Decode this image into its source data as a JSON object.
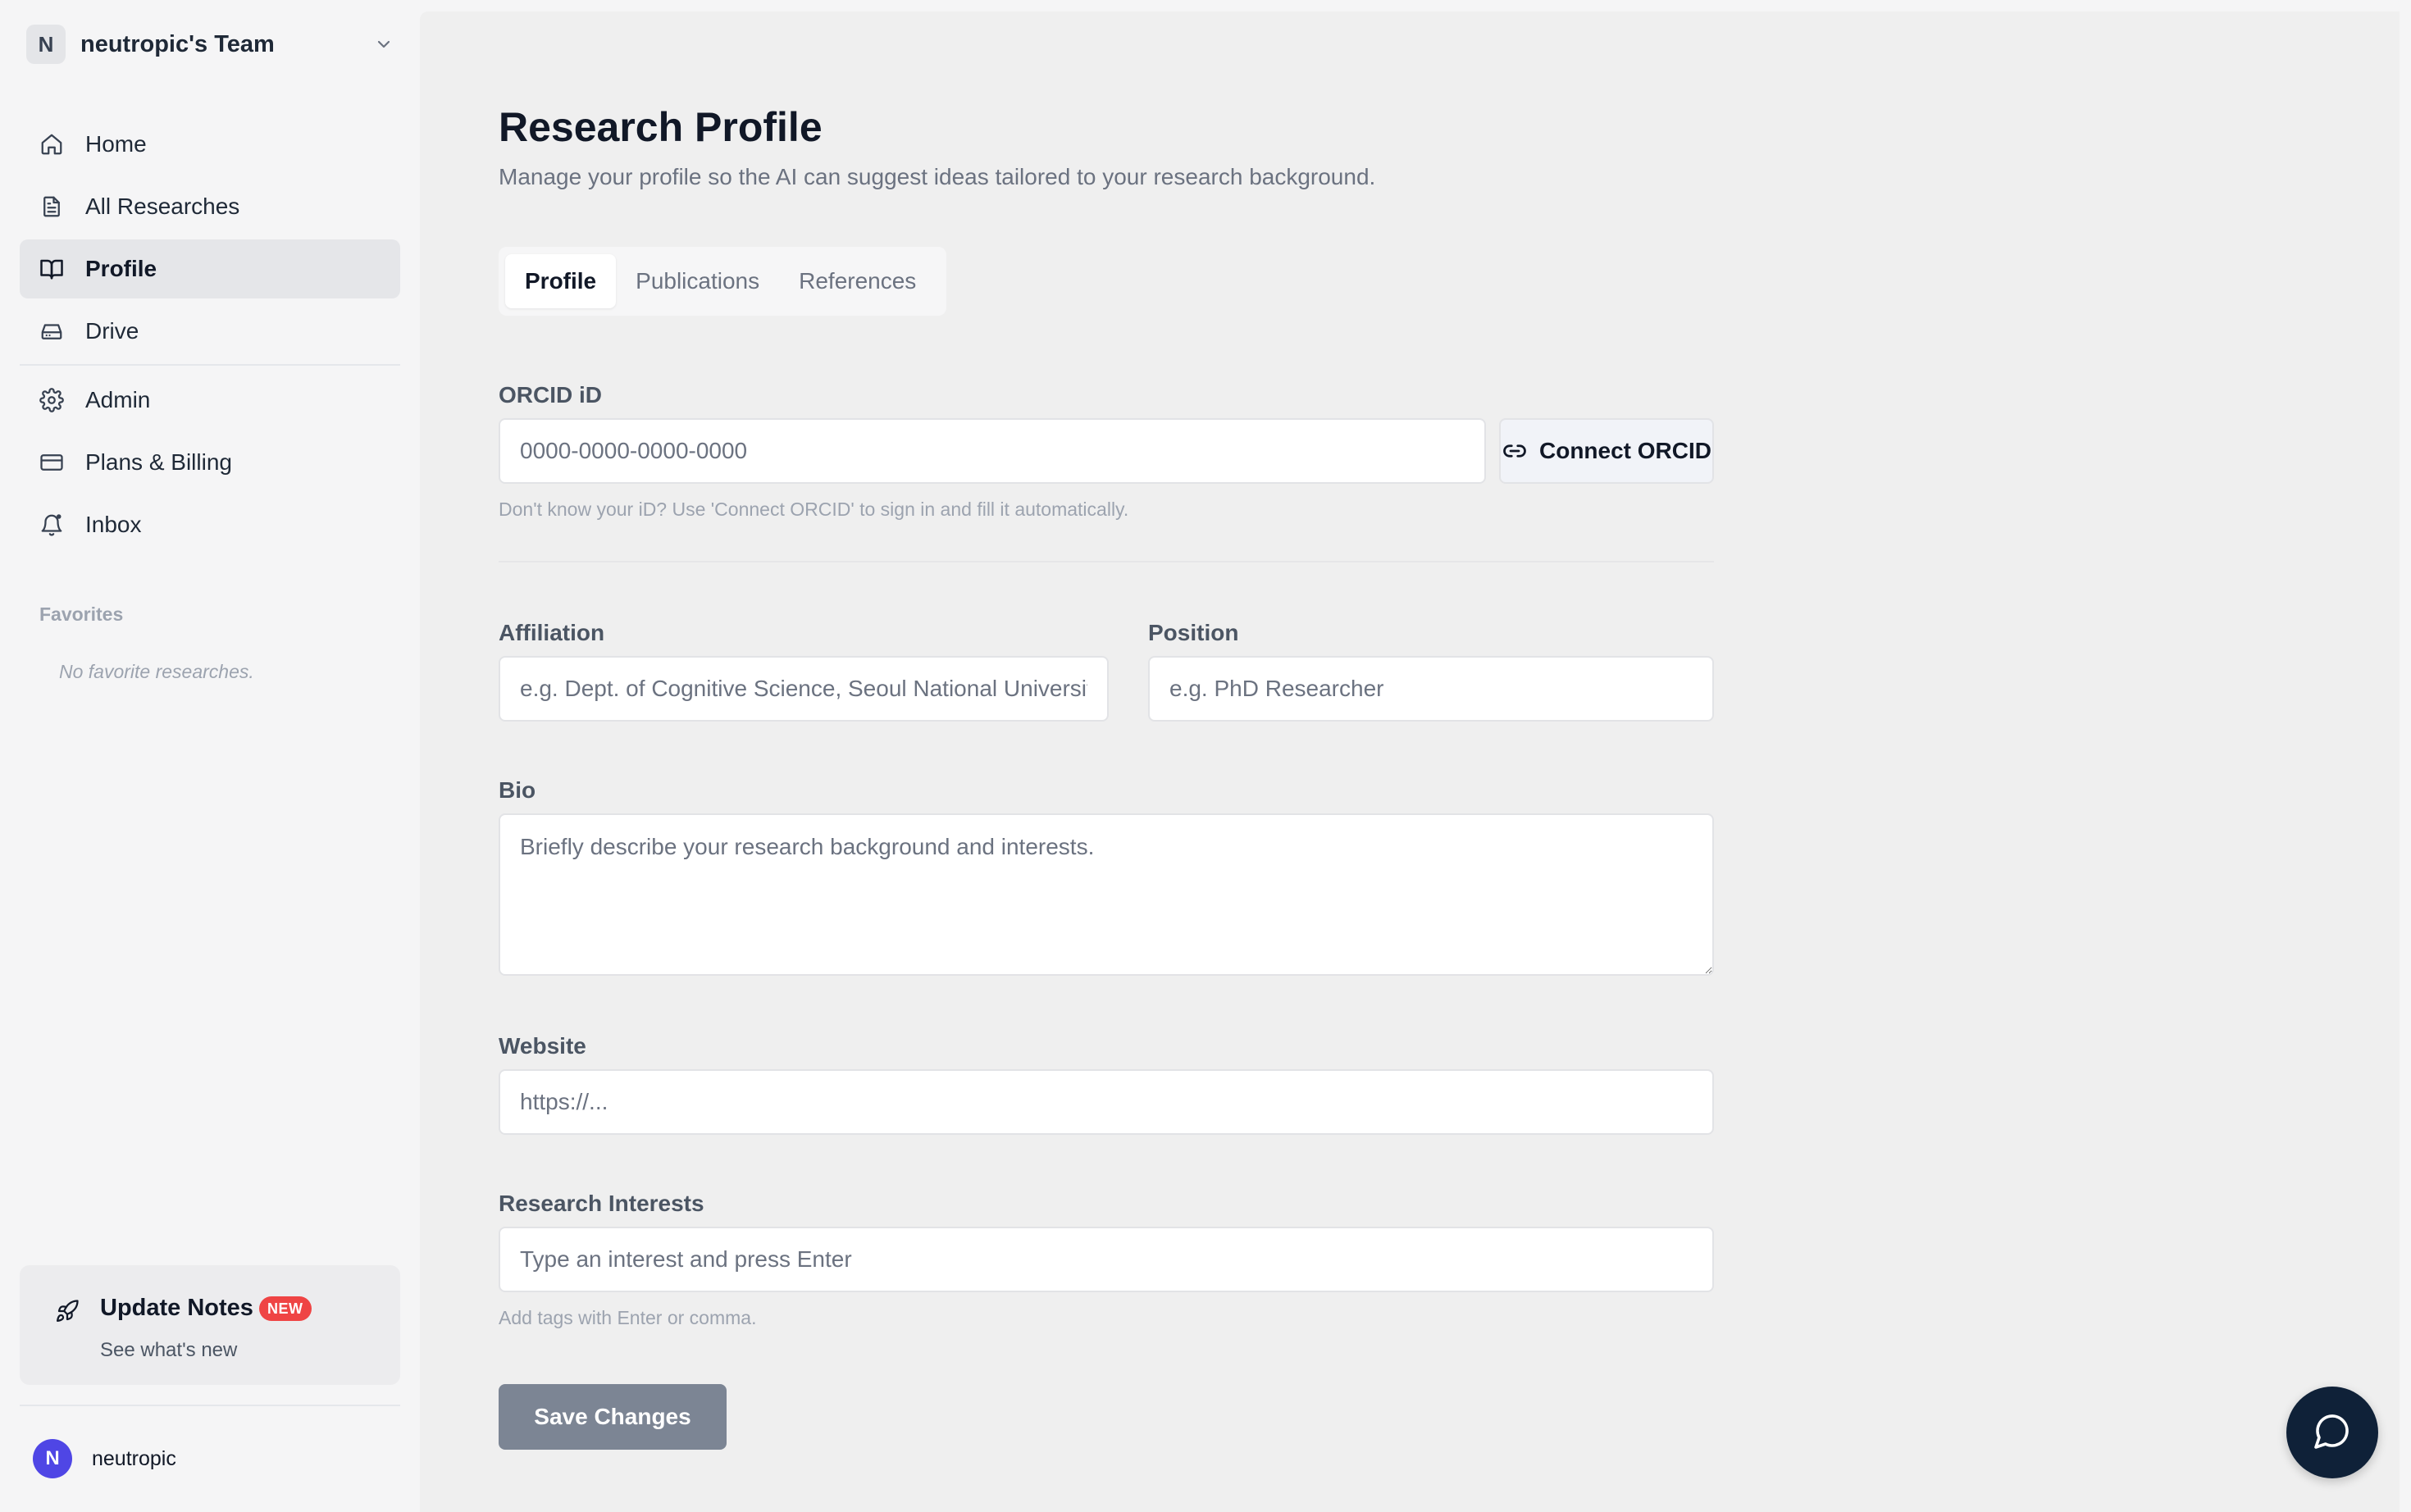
{
  "team": {
    "initial": "N",
    "name": "neutropic's Team"
  },
  "nav": {
    "items": [
      {
        "label": "Home",
        "icon": "home-icon"
      },
      {
        "label": "All Researches",
        "icon": "document-icon"
      },
      {
        "label": "Profile",
        "icon": "book-open-icon",
        "active": true
      },
      {
        "label": "Drive",
        "icon": "hard-drive-icon"
      },
      {
        "label": "Admin",
        "icon": "gear-icon"
      },
      {
        "label": "Plans & Billing",
        "icon": "credit-card-icon"
      },
      {
        "label": "Inbox",
        "icon": "bell-dot-icon"
      }
    ]
  },
  "favorites": {
    "title": "Favorites",
    "empty": "No favorite researches."
  },
  "update": {
    "title": "Update Notes",
    "badge": "NEW",
    "subtitle": "See what's new"
  },
  "user": {
    "initial": "N",
    "name": "neutropic"
  },
  "page": {
    "title": "Research Profile",
    "subtitle": "Manage your profile so the AI can suggest ideas tailored to your research background."
  },
  "tabs": [
    {
      "label": "Profile",
      "active": true
    },
    {
      "label": "Publications"
    },
    {
      "label": "References"
    }
  ],
  "form": {
    "orcid": {
      "label": "ORCID iD",
      "value": "",
      "placeholder": "0000-0000-0000-0000",
      "button": "Connect ORCID",
      "helper": "Don't know your iD? Use 'Connect ORCID' to sign in and fill it automatically."
    },
    "affiliation": {
      "label": "Affiliation",
      "value": "",
      "placeholder": "e.g. Dept. of Cognitive Science, Seoul National University"
    },
    "position": {
      "label": "Position",
      "value": "",
      "placeholder": "e.g. PhD Researcher"
    },
    "bio": {
      "label": "Bio",
      "value": "",
      "placeholder": "Briefly describe your research background and interests."
    },
    "website": {
      "label": "Website",
      "value": "",
      "placeholder": "https://..."
    },
    "interests": {
      "label": "Research Interests",
      "value": "",
      "placeholder": "Type an interest and press Enter",
      "helper": "Add tags with Enter or comma."
    },
    "save": "Save Changes"
  },
  "colors": {
    "accent_dark": "#0f2138",
    "badge": "#ef4444",
    "avatar": "#4f46e5",
    "save_button": "#7c8594"
  }
}
